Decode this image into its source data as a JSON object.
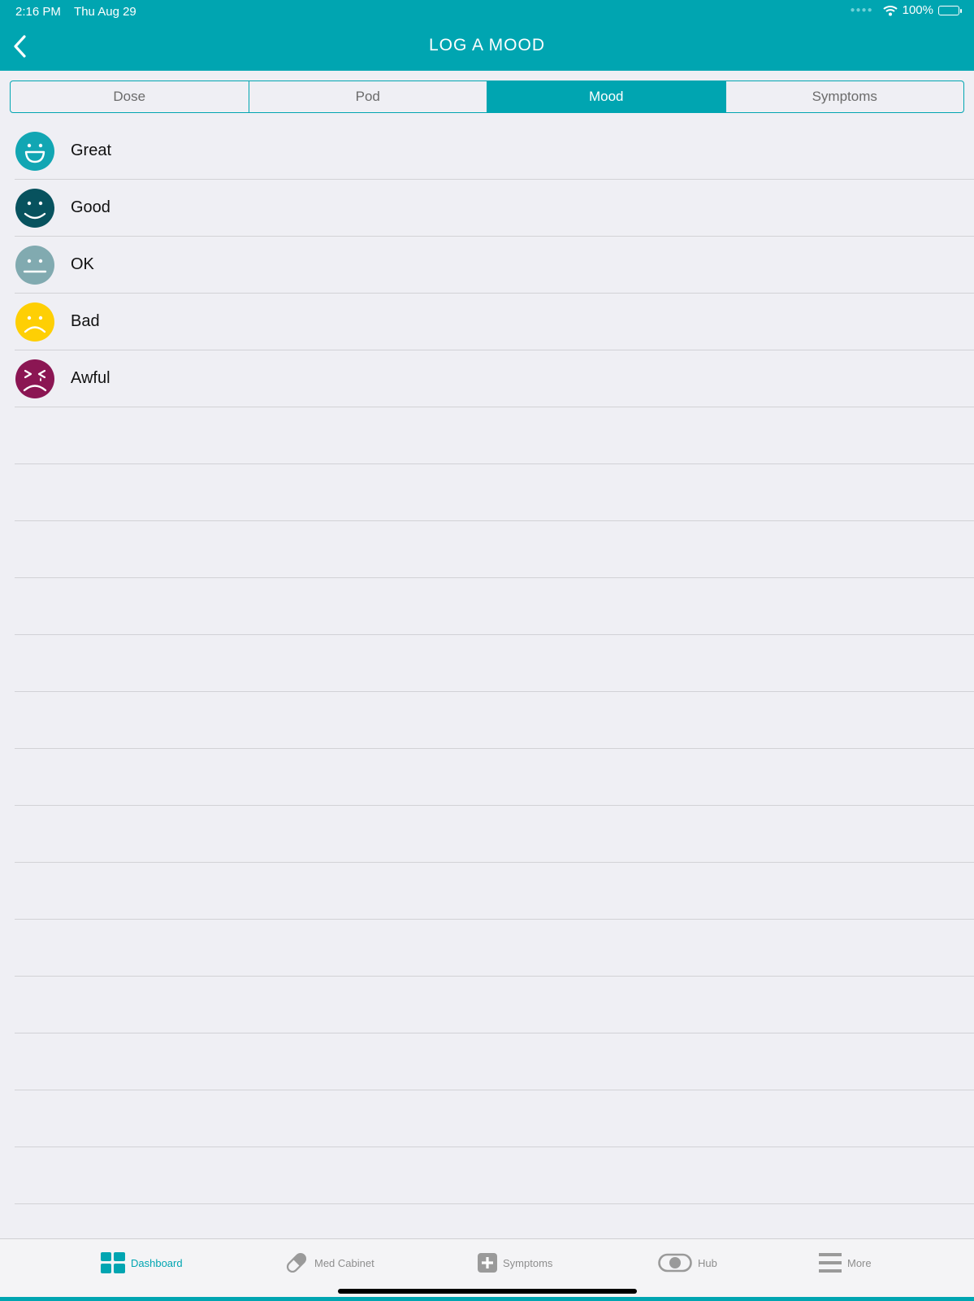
{
  "status_bar": {
    "time": "2:16 PM",
    "date": "Thu Aug 29",
    "battery": "100%"
  },
  "header": {
    "title": "LOG A MOOD"
  },
  "segments": [
    {
      "label": "Dose",
      "active": false
    },
    {
      "label": "Pod",
      "active": false
    },
    {
      "label": "Mood",
      "active": true
    },
    {
      "label": "Symptoms",
      "active": false
    }
  ],
  "moods": [
    {
      "label": "Great",
      "color": "#12a6b3",
      "icon": "great-face-icon"
    },
    {
      "label": "Good",
      "color": "#07525e",
      "icon": "good-face-icon"
    },
    {
      "label": "OK",
      "color": "#81aab0",
      "icon": "ok-face-icon"
    },
    {
      "label": "Bad",
      "color": "#fecf04",
      "icon": "bad-face-icon"
    },
    {
      "label": "Awful",
      "color": "#8b1653",
      "icon": "awful-face-icon"
    }
  ],
  "tabbar": {
    "items": [
      {
        "label": "Dashboard",
        "icon": "dashboard-icon",
        "active": true
      },
      {
        "label": "Med Cabinet",
        "icon": "pill-icon",
        "active": false
      },
      {
        "label": "Symptoms",
        "icon": "plus-box-icon",
        "active": false
      },
      {
        "label": "Hub",
        "icon": "toggle-icon",
        "active": false
      },
      {
        "label": "More",
        "icon": "menu-icon",
        "active": false
      }
    ]
  },
  "colors": {
    "accent": "#00a5b1",
    "background": "#efeff4",
    "inactive": "#8e8e8e"
  }
}
